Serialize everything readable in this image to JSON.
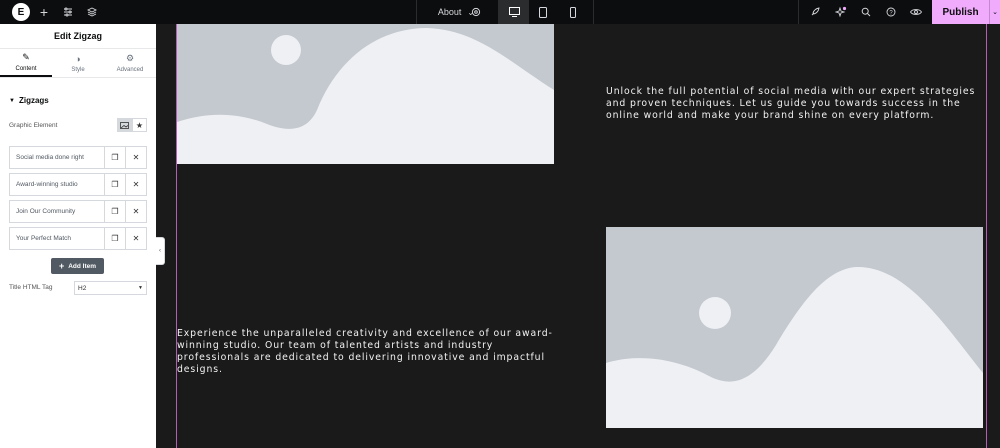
{
  "topbar": {
    "logo_letter": "E",
    "page_name": "About",
    "publish_label": "Publish",
    "caret": "⌄"
  },
  "panel": {
    "title": "Edit Zigzag",
    "tabs": [
      {
        "label": "Content",
        "icon": "✎"
      },
      {
        "label": "Style",
        "icon": "◑"
      },
      {
        "label": "Advanced",
        "icon": "⚙"
      }
    ],
    "section_title": "Zigzags",
    "graphic_element_label": "Graphic Element",
    "items": [
      {
        "label": "Social media done right"
      },
      {
        "label": "Award-winning studio"
      },
      {
        "label": "Join Our Community"
      },
      {
        "label": "Your Perfect Match"
      }
    ],
    "add_item_label": "Add Item",
    "title_tag_label": "Title HTML Tag",
    "title_tag_value": "H2"
  },
  "canvas": {
    "text_1": "Unlock the full potential of social media with our expert strategies and proven techniques. Let us guide you towards success in the online world and make your brand shine on every platform.",
    "text_2": "Experience the unparalleled creativity and excellence of our award-winning studio. Our team of talented artists and industry professionals are dedicated to delivering innovative and impactful designs."
  },
  "colors": {
    "publish_bg": "#f0abfc",
    "canvas_bg": "#1a1a1a",
    "topbar_bg": "#0c0d0e",
    "placeholder_bg": "#eff0f4",
    "placeholder_shape": "#c3c9cf"
  }
}
